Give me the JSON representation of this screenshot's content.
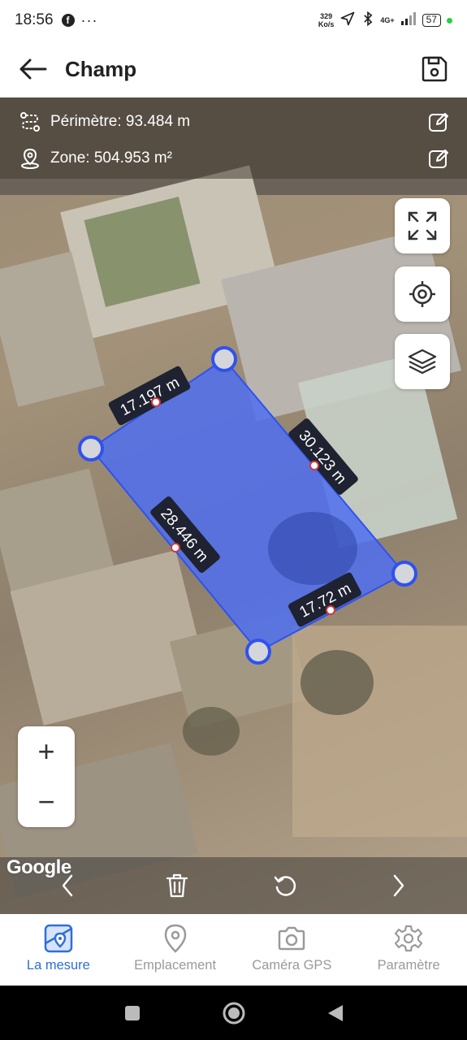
{
  "status_bar": {
    "time": "18:56",
    "dots": "···",
    "net_speed_value": "329",
    "net_speed_unit": "Ko/s",
    "network_type": "4G+",
    "battery": "57",
    "icons": [
      "facebook-icon",
      "navigation-icon",
      "bluetooth-icon",
      "signal-icon",
      "battery-icon"
    ]
  },
  "app_bar": {
    "title": "Champ",
    "back_icon": "arrow-left-icon",
    "save_icon": "save-icon"
  },
  "measurements": {
    "perimeter_label": "Périmètre: 93.484 m",
    "area_label": "Zone: 504.953 m²"
  },
  "polygon": {
    "fill_color": "#4f6ff0",
    "edge_labels": [
      "17.197 m",
      "30.123 m",
      "17.72 m",
      "28.446 m"
    ]
  },
  "map_controls": {
    "icons": [
      "fullscreen-icon",
      "locate-icon",
      "layers-icon"
    ],
    "zoom_in": "+",
    "zoom_out": "−"
  },
  "attribution": "Google",
  "edit_bar": {
    "icons": [
      "chevron-left-icon",
      "trash-icon",
      "undo-icon",
      "chevron-right-icon"
    ]
  },
  "bottom_nav": {
    "accent_color": "#2f6fd6",
    "items": [
      {
        "label": "La mesure",
        "icon": "map-measure-icon",
        "active": true
      },
      {
        "label": "Emplacement",
        "icon": "location-pin-icon",
        "active": false
      },
      {
        "label": "Caméra GPS",
        "icon": "camera-icon",
        "active": false
      },
      {
        "label": "Paramètre",
        "icon": "gear-icon",
        "active": false
      }
    ]
  }
}
